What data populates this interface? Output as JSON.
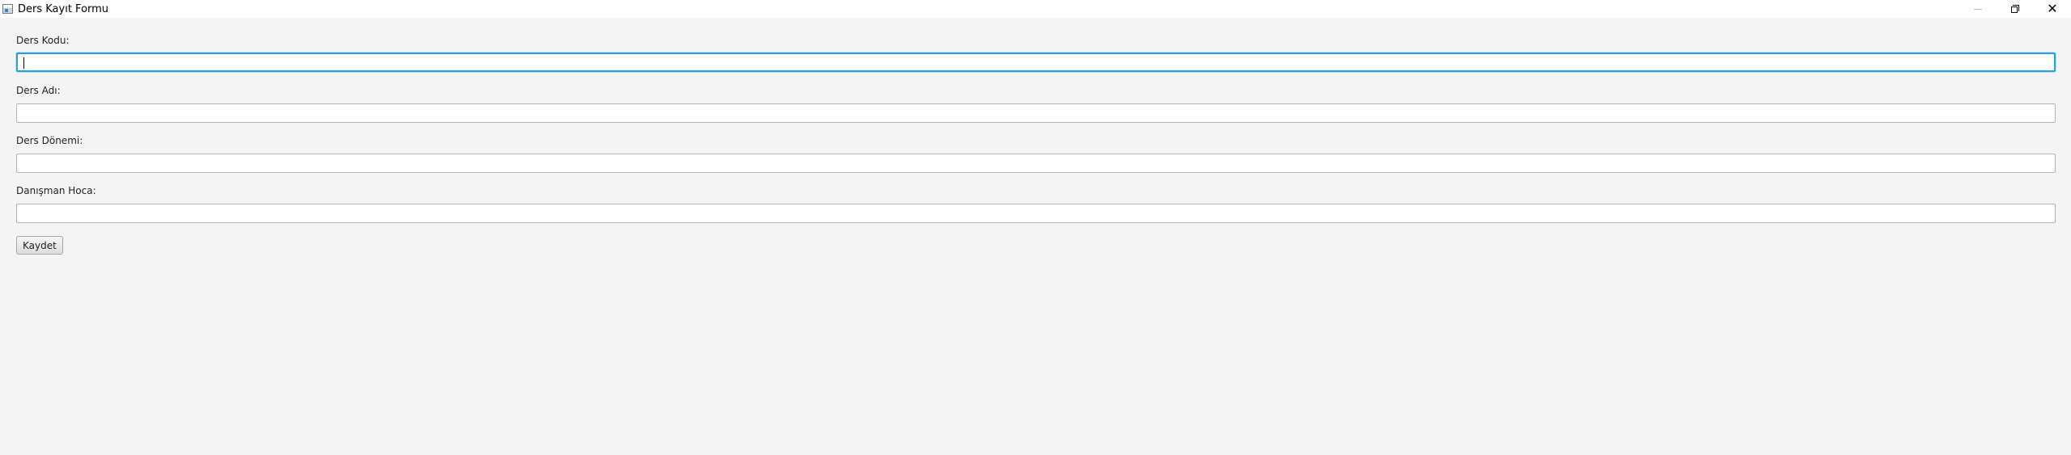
{
  "window": {
    "title": "Ders Kayıt Formu",
    "minimize_label": "—",
    "maximize_label": "❐",
    "close_label": "✕"
  },
  "form": {
    "fields": [
      {
        "label": "Ders Kodu:",
        "value": "",
        "focused": true
      },
      {
        "label": "Ders Adı:",
        "value": "",
        "focused": false
      },
      {
        "label": "Ders Dönemi:",
        "value": "",
        "focused": false
      },
      {
        "label": "Danışman Hoca:",
        "value": "",
        "focused": false
      }
    ],
    "save_label": "Kaydet"
  },
  "colors": {
    "background": "#f4f4f4",
    "focus_border": "#2d9fd8",
    "input_border": "#b5b5b5"
  }
}
